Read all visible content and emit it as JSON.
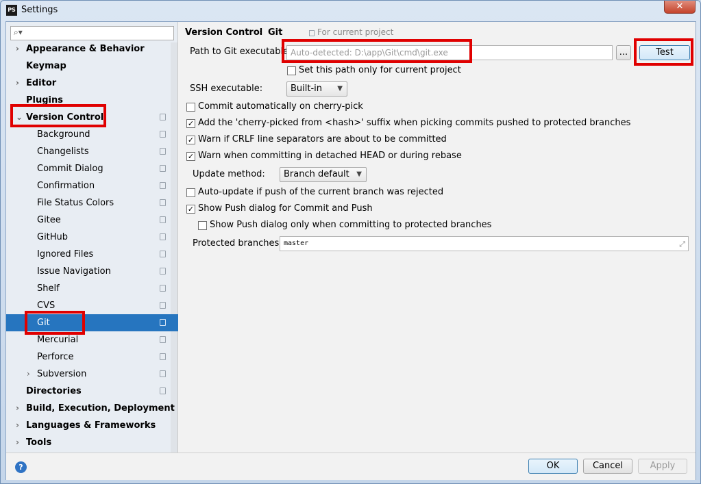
{
  "window": {
    "title": "Settings",
    "logo": "PS",
    "close_glyph": "✕"
  },
  "search": {
    "placeholder": ""
  },
  "sidebar": {
    "items": [
      {
        "label": "Appearance & Behavior",
        "arrow": "›"
      },
      {
        "label": "Keymap"
      },
      {
        "label": "Editor",
        "arrow": "›"
      },
      {
        "label": "Plugins"
      },
      {
        "label": "Version Control",
        "arrow": "⌄"
      },
      {
        "label": "Background"
      },
      {
        "label": "Changelists"
      },
      {
        "label": "Commit Dialog"
      },
      {
        "label": "Confirmation"
      },
      {
        "label": "File Status Colors"
      },
      {
        "label": "Gitee"
      },
      {
        "label": "GitHub"
      },
      {
        "label": "Ignored Files"
      },
      {
        "label": "Issue Navigation"
      },
      {
        "label": "Shelf"
      },
      {
        "label": "CVS"
      },
      {
        "label": "Git"
      },
      {
        "label": "Mercurial"
      },
      {
        "label": "Perforce"
      },
      {
        "label": "Subversion",
        "arrow": "›"
      },
      {
        "label": "Directories"
      },
      {
        "label": "Build, Execution, Deployment",
        "arrow": "›"
      },
      {
        "label": "Languages & Frameworks",
        "arrow": "›"
      },
      {
        "label": "Tools",
        "arrow": "›"
      }
    ]
  },
  "breadcrumb": {
    "parent": "Version Control",
    "separator": "›",
    "current": "Git",
    "scope": "For current project"
  },
  "git": {
    "path_label": "Path to Git executable:",
    "path_placeholder": "Auto-detected: D:\\app\\Git\\cmd\\git.exe",
    "browse_label": "...",
    "test_label": "Test",
    "current_project_only": "Set this path only for current project",
    "ssh_label": "SSH executable:",
    "ssh_value": "Built-in",
    "opt_cherry_pick": "Commit automatically on cherry-pick",
    "opt_cherry_suffix": "Add the 'cherry-picked from <hash>' suffix when picking commits pushed to protected branches",
    "opt_crlf": "Warn if CRLF line separators are about to be committed",
    "opt_detached": "Warn when committing in detached HEAD or during rebase",
    "update_label": "Update method:",
    "update_value": "Branch default",
    "opt_autoupdate": "Auto-update if push of the current branch was rejected",
    "opt_show_push": "Show Push dialog for Commit and Push",
    "opt_show_push_protected": "Show Push dialog only when committing to protected branches",
    "protected_label": "Protected branches:",
    "protected_value": "master",
    "checked_glyph": "✓",
    "chevron_glyph": "▼",
    "expand_glyph": "⤢"
  },
  "footer": {
    "help": "?",
    "ok": "OK",
    "cancel": "Cancel",
    "apply": "Apply"
  },
  "colors": {
    "selection": "#2675bf",
    "highlight": "#e00000"
  }
}
